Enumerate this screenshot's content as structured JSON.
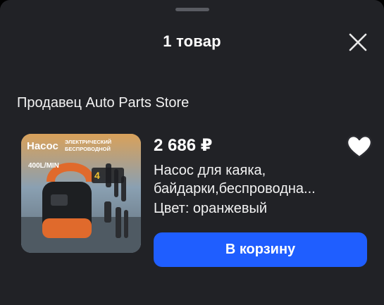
{
  "header": {
    "title": "1 товар"
  },
  "seller": {
    "label": "Продавец Auto Parts Store"
  },
  "product": {
    "price": "2 686 ₽",
    "name_line1": "Насос для каяка,",
    "name_line2": "байдарки,беспроводна...",
    "color_label": "Цвет: оранжевый",
    "image_texts": {
      "brand": "Насос",
      "tagline1": "ЭЛЕКТРИЧЕСКИЙ",
      "tagline2": "БЕСПРОВОДНОЙ",
      "flow": "400L/MIN",
      "modes": "4"
    }
  },
  "actions": {
    "cart_button": "В корзину"
  },
  "icons": {
    "close": "close-icon",
    "favorite": "heart-icon"
  },
  "colors": {
    "sheet": "#212226",
    "accent": "#1f5eff",
    "product_orange": "#e06a2c"
  }
}
